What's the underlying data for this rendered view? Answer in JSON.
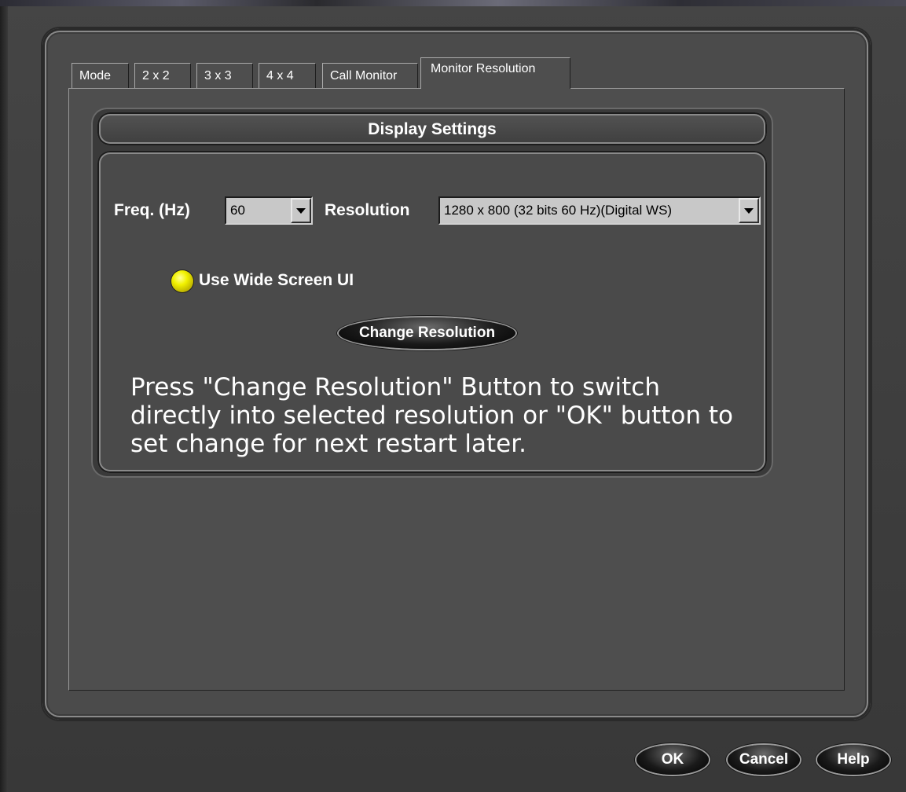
{
  "tabs": [
    "Mode",
    "2 x 2",
    "3 x 3",
    "4 x 4",
    "Call Monitor",
    "Monitor Resolution"
  ],
  "group": {
    "title": "Display Settings"
  },
  "freq": {
    "label": "Freq. (Hz)",
    "value": "60"
  },
  "resolution": {
    "label": "Resolution",
    "value": "1280 x 800 (32 bits 60 Hz)(Digital WS)"
  },
  "wide_screen": {
    "label": "Use Wide Screen UI",
    "selected": true,
    "indicator_color": "#f2f200"
  },
  "change_button": "Change Resolution",
  "info_text": "Press \"Change Resolution\" Button to switch directly into selected resolution or \"OK\" button to set change for next restart later.",
  "footer": {
    "ok": "OK",
    "cancel": "Cancel",
    "help": "Help"
  }
}
